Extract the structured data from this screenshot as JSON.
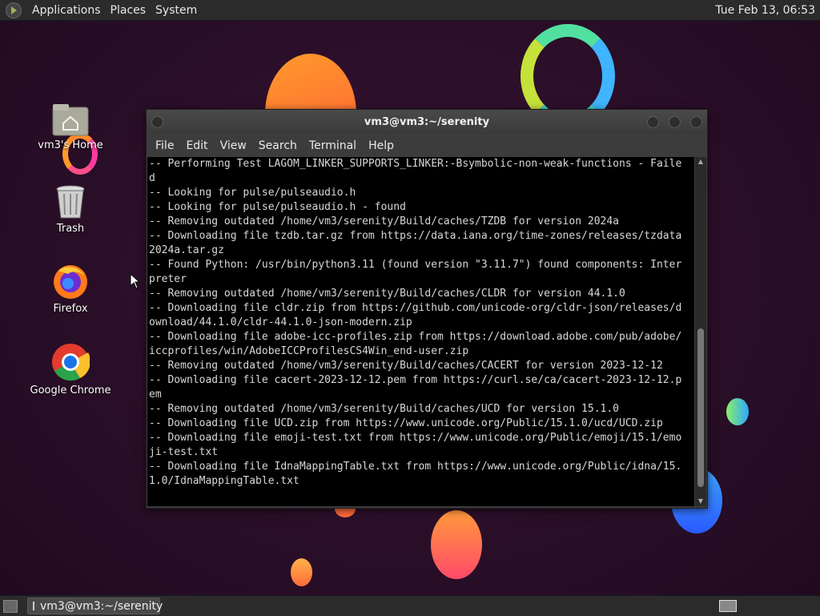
{
  "top_panel": {
    "menus": [
      "Applications",
      "Places",
      "System"
    ],
    "clock": "Tue Feb 13, 06:53"
  },
  "desktop_icons": [
    {
      "label": "vm3's Home",
      "icon": "home-folder-icon"
    },
    {
      "label": "Trash",
      "icon": "trash-icon"
    },
    {
      "label": "Firefox",
      "icon": "firefox-icon"
    },
    {
      "label": "Google Chrome",
      "icon": "chrome-icon"
    }
  ],
  "terminal": {
    "title": "vm3@vm3:~/serenity",
    "menu": [
      "File",
      "Edit",
      "View",
      "Search",
      "Terminal",
      "Help"
    ],
    "lines": [
      "-- Performing Test LAGOM_LINKER_SUPPORTS_LINKER:-Bsymbolic-non-weak-functions - Faile",
      "d",
      "-- Looking for pulse/pulseaudio.h",
      "-- Looking for pulse/pulseaudio.h - found",
      "-- Removing outdated /home/vm3/serenity/Build/caches/TZDB for version 2024a",
      "-- Downloading file tzdb.tar.gz from https://data.iana.org/time-zones/releases/tzdata",
      "2024a.tar.gz",
      "-- Found Python: /usr/bin/python3.11 (found version \"3.11.7\") found components: Inter",
      "preter",
      "-- Removing outdated /home/vm3/serenity/Build/caches/CLDR for version 44.1.0",
      "-- Downloading file cldr.zip from https://github.com/unicode-org/cldr-json/releases/d",
      "ownload/44.1.0/cldr-44.1.0-json-modern.zip",
      "-- Downloading file adobe-icc-profiles.zip from https://download.adobe.com/pub/adobe/",
      "iccprofiles/win/AdobeICCProfilesCS4Win_end-user.zip",
      "-- Removing outdated /home/vm3/serenity/Build/caches/CACERT for version 2023-12-12",
      "-- Downloading file cacert-2023-12-12.pem from https://curl.se/ca/cacert-2023-12-12.p",
      "em",
      "-- Removing outdated /home/vm3/serenity/Build/caches/UCD for version 15.1.0",
      "-- Downloading file UCD.zip from https://www.unicode.org/Public/15.1.0/ucd/UCD.zip",
      "-- Downloading file emoji-test.txt from https://www.unicode.org/Public/emoji/15.1/emo",
      "ji-test.txt",
      "-- Downloading file IdnaMappingTable.txt from https://www.unicode.org/Public/idna/15.",
      "1.0/IdnaMappingTable.txt"
    ],
    "scroll": {
      "thumb_start": 0.49,
      "thumb_end": 0.97
    }
  },
  "taskbar": {
    "task_label": "vm3@vm3:~/serenity"
  }
}
